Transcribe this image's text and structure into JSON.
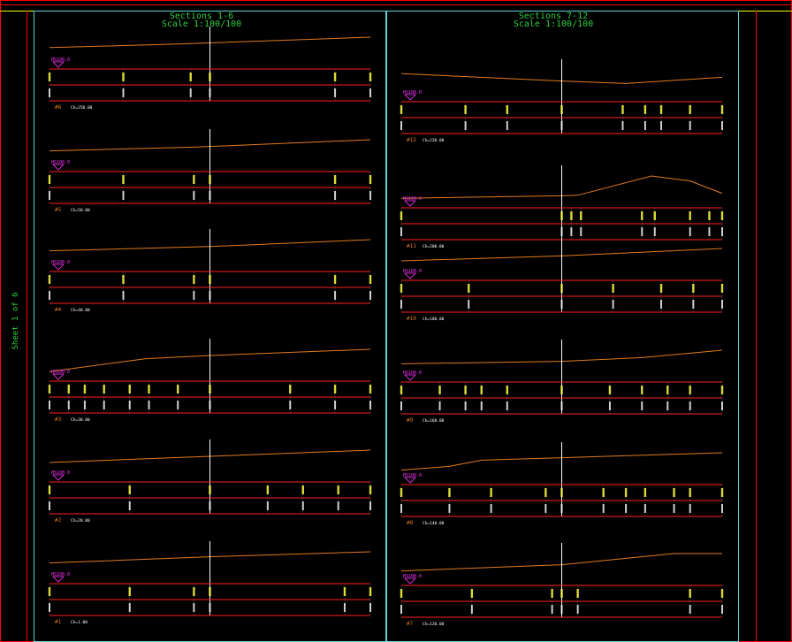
{
  "sheet": {
    "left_title": "Sections 1-6",
    "left_scale": "Scale 1:100/100",
    "right_title": "Sections 7-12",
    "right_scale": "Scale 1:100/100",
    "sheet_label": "Sheet 1 of 6"
  },
  "colors": {
    "frame_red": "#ff0000",
    "frame_yellow": "#ffff00",
    "frame_cyan": "#5fd3d3",
    "title_green": "#2ecc40",
    "ground_orange": "#e07a20",
    "band_red": "#ff2020",
    "label_yellow": "#ffff33",
    "label_white": "#ffffff",
    "datum_magenta": "#ff33ff"
  },
  "sections_left": [
    {
      "id": "#6",
      "chainage": "Ch=250.00",
      "datum": "HS100.0",
      "ground": [
        [
          0,
          0.58
        ],
        [
          0.4,
          0.72
        ],
        [
          1,
          1.0
        ]
      ],
      "ticks": [
        0,
        0.23,
        0.44,
        0.5,
        0.89,
        1
      ]
    },
    {
      "id": "#5",
      "chainage": "Ch=50.00",
      "datum": "HS100.0",
      "ground": [
        [
          0,
          0.55
        ],
        [
          0.45,
          0.7
        ],
        [
          1,
          1.0
        ]
      ],
      "ticks": [
        0,
        0.23,
        0.45,
        0.5,
        0.89,
        1
      ]
    },
    {
      "id": "#4",
      "chainage": "Ch=40.00",
      "datum": "HS100.0",
      "ground": [
        [
          0,
          0.55
        ],
        [
          0.5,
          0.72
        ],
        [
          1,
          1.0
        ]
      ],
      "ticks": [
        0,
        0.23,
        0.45,
        0.5,
        0.89,
        1
      ]
    },
    {
      "id": "#3",
      "chainage": "Ch=30.00",
      "datum": "HS100.0",
      "ground": [
        [
          0,
          0.1
        ],
        [
          0.3,
          0.62
        ],
        [
          0.5,
          0.75
        ],
        [
          1,
          1.0
        ]
      ],
      "ticks": [
        0,
        0.06,
        0.11,
        0.17,
        0.25,
        0.31,
        0.4,
        0.5,
        0.75,
        0.89,
        1
      ]
    },
    {
      "id": "#2",
      "chainage": "Ch=20.00",
      "datum": "HS100.0",
      "ground": [
        [
          0,
          0.5
        ],
        [
          0.5,
          0.75
        ],
        [
          1,
          1.0
        ]
      ],
      "ticks": [
        0,
        0.25,
        0.5,
        0.68,
        0.79,
        0.9,
        1
      ]
    },
    {
      "id": "#1",
      "chainage": "Ch=1.00",
      "datum": "HS100.0",
      "ground": [
        [
          0,
          0.55
        ],
        [
          0.5,
          0.8
        ],
        [
          1,
          1.0
        ]
      ],
      "ticks": [
        0,
        0.25,
        0.45,
        0.5,
        0.92,
        1
      ]
    }
  ],
  "sections_right": [
    {
      "id": "#12",
      "chainage": "Ch=220.00",
      "datum": "HS100.0",
      "ground": [
        [
          0,
          0.85
        ],
        [
          0.5,
          0.55
        ],
        [
          0.7,
          0.45
        ],
        [
          1,
          0.7
        ]
      ],
      "ticks": [
        0,
        0.2,
        0.33,
        0.5,
        0.69,
        0.76,
        0.81,
        0.9,
        1
      ]
    },
    {
      "id": "#11",
      "chainage": "Ch=200.00",
      "datum": "HS100.0",
      "ground": [
        [
          0,
          0.1
        ],
        [
          0.5,
          0.2
        ],
        [
          0.55,
          0.22
        ],
        [
          0.78,
          1.0
        ],
        [
          0.9,
          0.8
        ],
        [
          1,
          0.3
        ]
      ],
      "ticks": [
        0,
        0.5,
        0.53,
        0.56,
        0.75,
        0.79,
        0.9,
        0.96,
        1
      ]
    },
    {
      "id": "#10",
      "chainage": "Ch=180.00",
      "datum": "HS100.0",
      "ground": [
        [
          0,
          0.5
        ],
        [
          0.5,
          0.7
        ],
        [
          1,
          1.0
        ]
      ],
      "ticks": [
        0,
        0.21,
        0.5,
        0.66,
        0.81,
        0.91,
        1
      ]
    },
    {
      "id": "#9",
      "chainage": "Ch=160.00",
      "datum": "HS100.0",
      "ground": [
        [
          0,
          0.45
        ],
        [
          0.5,
          0.55
        ],
        [
          0.75,
          0.7
        ],
        [
          1,
          1.0
        ]
      ],
      "ticks": [
        0,
        0.12,
        0.2,
        0.25,
        0.33,
        0.5,
        0.65,
        0.75,
        0.83,
        0.9,
        1
      ]
    },
    {
      "id": "#8",
      "chainage": "Ch=140.00",
      "datum": "HS100.0",
      "ground": [
        [
          0,
          0.3
        ],
        [
          0.15,
          0.45
        ],
        [
          0.25,
          0.7
        ],
        [
          0.5,
          0.8
        ],
        [
          1,
          1.0
        ]
      ],
      "ticks": [
        0,
        0.15,
        0.28,
        0.45,
        0.5,
        0.63,
        0.7,
        0.76,
        0.85,
        0.9,
        1
      ]
    },
    {
      "id": "#7",
      "chainage": "Ch=120.00",
      "datum": "HS100.0",
      "ground": [
        [
          0,
          0.3
        ],
        [
          0.5,
          0.55
        ],
        [
          0.85,
          1.0
        ],
        [
          1,
          1.0
        ]
      ],
      "ticks": [
        0,
        0.22,
        0.47,
        0.5,
        0.55,
        0.9,
        1
      ]
    }
  ]
}
